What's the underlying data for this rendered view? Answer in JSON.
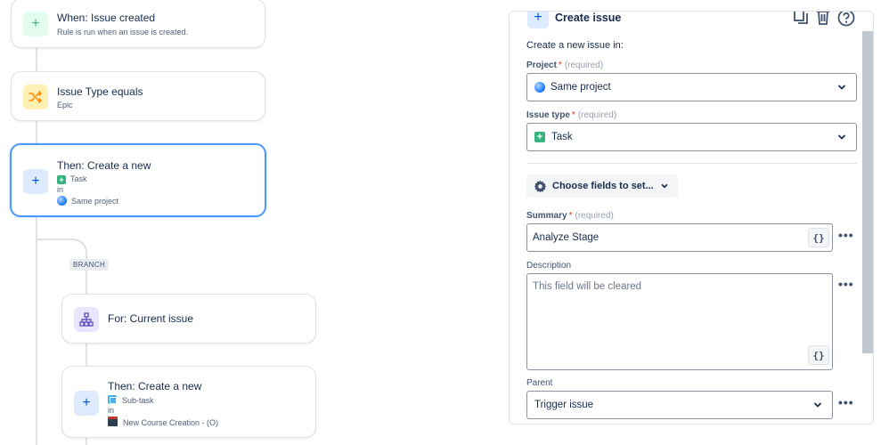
{
  "flow": {
    "trigger": {
      "title": "When: Issue created",
      "subtitle": "Rule is run when an issue is created."
    },
    "condition": {
      "title": "Issue Type equals",
      "subtitle": "Epic"
    },
    "action": {
      "title": "Then: Create a new",
      "issue_type": "Task",
      "in_label": "in",
      "project": "Same project"
    },
    "branch": {
      "badge": "BRANCH"
    },
    "branch_rule": {
      "title": "For: Current issue"
    },
    "sub_action": {
      "title": "Then: Create a new",
      "issue_type": "Sub-task",
      "in_label": "in",
      "project": "New Course Creation - (O)"
    }
  },
  "panel": {
    "title": "Create issue",
    "intro": "Create a new issue in:",
    "required_mark": "*",
    "required_text": "(required)",
    "project": {
      "label": "Project",
      "value": "Same project"
    },
    "issue_type": {
      "label": "Issue type",
      "value": "Task"
    },
    "choose_fields": "Choose fields to set...",
    "summary": {
      "label": "Summary",
      "value": "Analyze Stage",
      "smart": "{}"
    },
    "description": {
      "label": "Description",
      "placeholder": "This field will be cleared",
      "smart": "{}"
    },
    "parent": {
      "label": "Parent",
      "value": "Trigger issue"
    },
    "more": "•••"
  },
  "colors": {
    "selected_border": "#4c9aff",
    "task_green": "#36b37e",
    "brand_blue": "#0052cc"
  },
  "icons": [
    "plus-icon",
    "shuffle-icon",
    "hierarchy-icon",
    "copy-icon",
    "trash-icon",
    "help-icon",
    "gear-icon",
    "chevron-down-icon"
  ]
}
